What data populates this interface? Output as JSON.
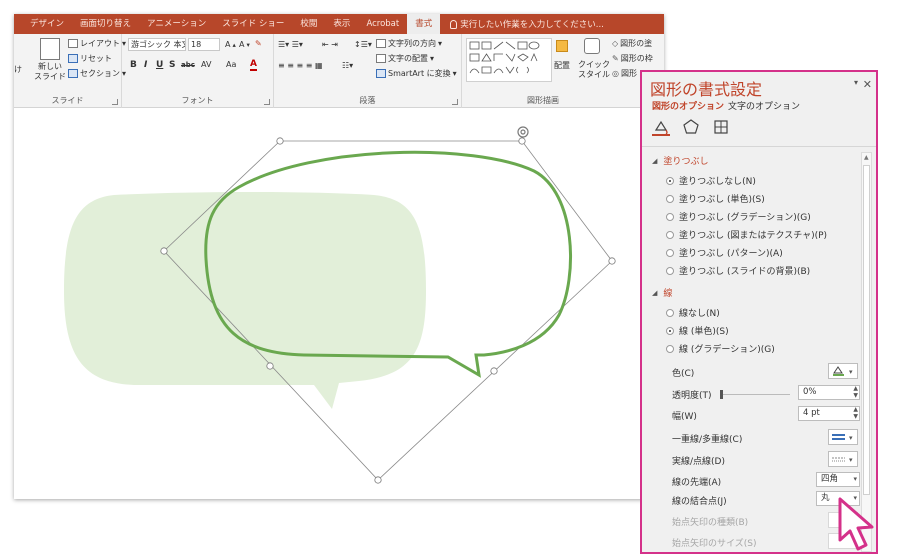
{
  "ribbon": {
    "tabs": [
      "デザイン",
      "画面切り替え",
      "アニメーション",
      "スライド ショー",
      "校閲",
      "表示",
      "Acrobat",
      "書式"
    ],
    "active_tab": "書式",
    "tell_me": "実行したい作業を入力してください...",
    "slides_group": {
      "label": "スライド",
      "new_slide": "新しい\nスライド",
      "paste_fragment": "け",
      "layout": "レイアウト",
      "reset": "リセット",
      "section": "セクション"
    },
    "font_group": {
      "label": "フォント",
      "font_name": "游ゴシック 本文",
      "font_size": "18",
      "bold": "B",
      "italic": "I",
      "underline": "U",
      "shadow": "S",
      "strike": "abc",
      "spacing": "AV",
      "case": "Aa",
      "color": "A"
    },
    "paragraph_group": {
      "label": "段落",
      "text_direction": "文字列の方向",
      "text_align": "文字の配置",
      "smartart": "SmartArt に変換"
    },
    "drawing_group": {
      "label": "図形描画",
      "arrange": "配置",
      "quick_styles": "クイック\nスタイル",
      "shape_fill": "図形の塗",
      "shape_outline": "図形の枠",
      "shape_effects": "図形"
    }
  },
  "pane": {
    "title": "図形の書式設定",
    "tabs": [
      "図形のオプション",
      "文字のオプション"
    ],
    "active_tab": "図形のオプション",
    "fill_section": {
      "title": "塗りつぶし",
      "options": [
        {
          "label": "塗りつぶしなし(N)",
          "selected": true
        },
        {
          "label": "塗りつぶし (単色)(S)",
          "selected": false
        },
        {
          "label": "塗りつぶし (グラデーション)(G)",
          "selected": false
        },
        {
          "label": "塗りつぶし (図またはテクスチャ)(P)",
          "selected": false
        },
        {
          "label": "塗りつぶし (パターン)(A)",
          "selected": false
        },
        {
          "label": "塗りつぶし (スライドの背景)(B)",
          "selected": false
        }
      ]
    },
    "line_section": {
      "title": "線",
      "options": [
        {
          "label": "線なし(N)",
          "selected": false
        },
        {
          "label": "線 (単色)(S)",
          "selected": true
        },
        {
          "label": "線 (グラデーション)(G)",
          "selected": false
        }
      ],
      "props": {
        "color_label": "色(C)",
        "transparency_label": "透明度(T)",
        "transparency_value": "0%",
        "width_label": "幅(W)",
        "width_value": "4 pt",
        "compound_label": "一重線/多重線(C)",
        "dash_label": "実線/点線(D)",
        "cap_label": "線の先端(A)",
        "cap_value": "四角",
        "join_label": "線の結合点(J)",
        "join_value": "丸",
        "begin_arrow_type_label": "始点矢印の種類(B)",
        "begin_arrow_size_label": "始点矢印のサイズ(S)"
      }
    }
  },
  "colors": {
    "ribbon_red": "#b7472a",
    "pane_border": "#d4318a",
    "shape_outline": "#6aa84f",
    "ghost_fill": "#e2efd9"
  }
}
